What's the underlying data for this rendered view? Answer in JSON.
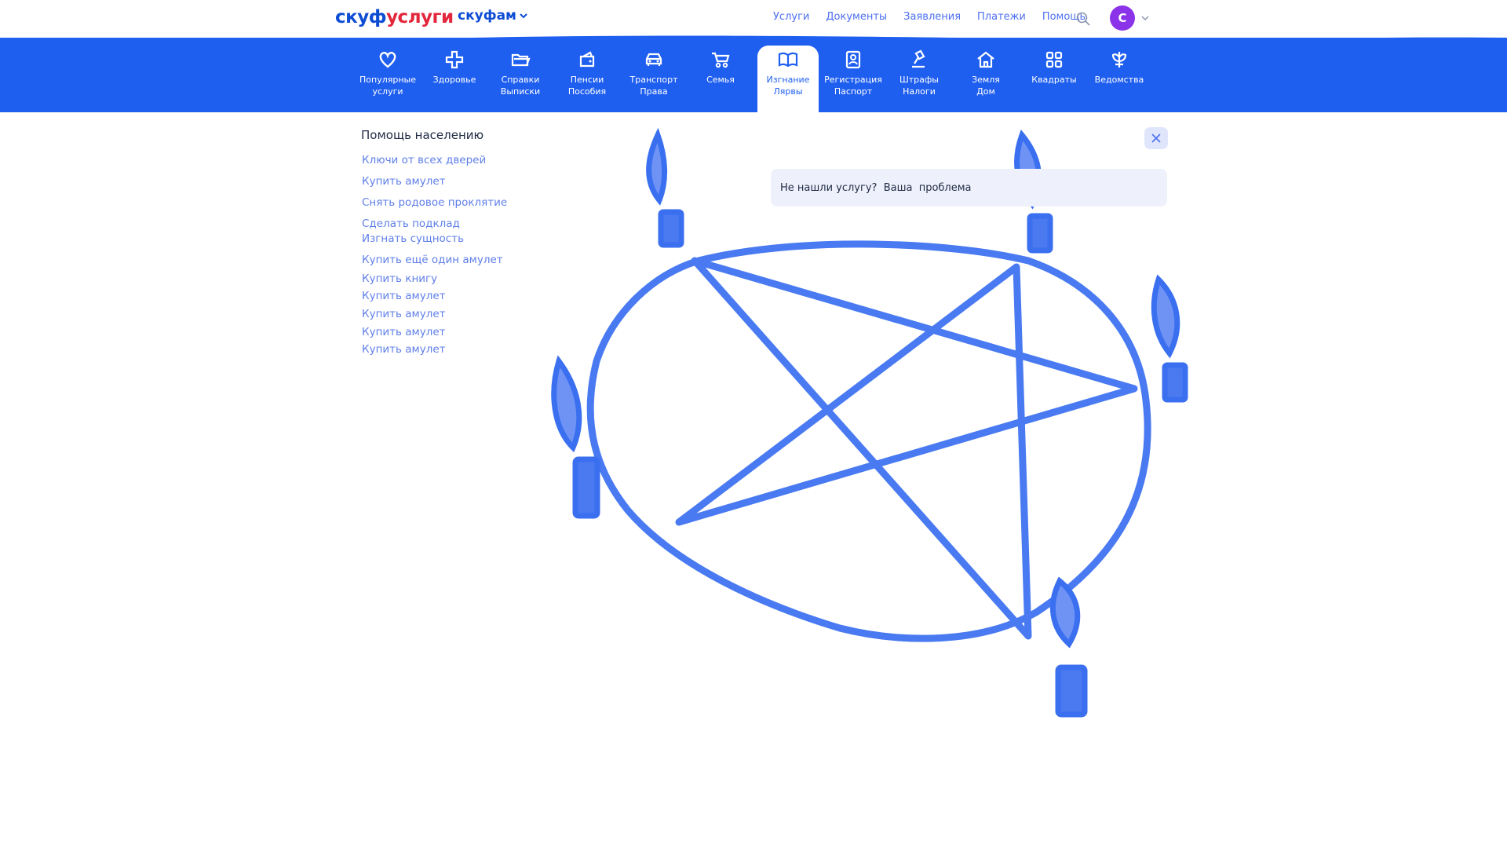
{
  "header": {
    "logo_part1": "скуф",
    "logo_part2": "услуги",
    "family_label": "скуфам",
    "nav": [
      "Услуги",
      "Документы",
      "Заявления",
      "Платежи",
      "Помощь"
    ],
    "avatar_letter": "С",
    "accent_color": "#1f5ff0",
    "avatar_color": "#8b33e8"
  },
  "categories": [
    {
      "label": "Популярные услуги",
      "icon": "heart-icon"
    },
    {
      "label": "Здоровье",
      "icon": "medical-cross-icon"
    },
    {
      "label": "Справки Выписки",
      "icon": "folder-icon"
    },
    {
      "label": "Пенсии Пособия",
      "icon": "wallet-icon"
    },
    {
      "label": "Транспорт Права",
      "icon": "car-icon"
    },
    {
      "label": "Семья",
      "icon": "stroller-icon"
    },
    {
      "label": "Изгнание Лярвы",
      "icon": "open-book-icon",
      "active": true
    },
    {
      "label": "Регистрация Паспорт",
      "icon": "passport-icon"
    },
    {
      "label": "Штрафы Налоги",
      "icon": "gavel-icon"
    },
    {
      "label": "Земля Дом",
      "icon": "house-icon"
    },
    {
      "label": "Квадраты",
      "icon": "grid-icon"
    },
    {
      "label": "Ведомства",
      "icon": "emblem-icon"
    }
  ],
  "sidebar": {
    "title": "Помощь населению",
    "items": [
      "Ключи от всех дверей",
      "Купить амулет",
      "Снять родовое проклятие",
      "Сделать подклад",
      "Изгнать сущность",
      "Купить  ещё один  амулет",
      "Купить книгу",
      "Купить амулет",
      "Купить амулет",
      "Купить амулет",
      "Купить амулет"
    ]
  },
  "search": {
    "value": "Не нашли услугу?  Ваша  проблема"
  },
  "drawing": {
    "subject": "pentagram-with-candles",
    "stroke_color": "#3a6ff0"
  }
}
